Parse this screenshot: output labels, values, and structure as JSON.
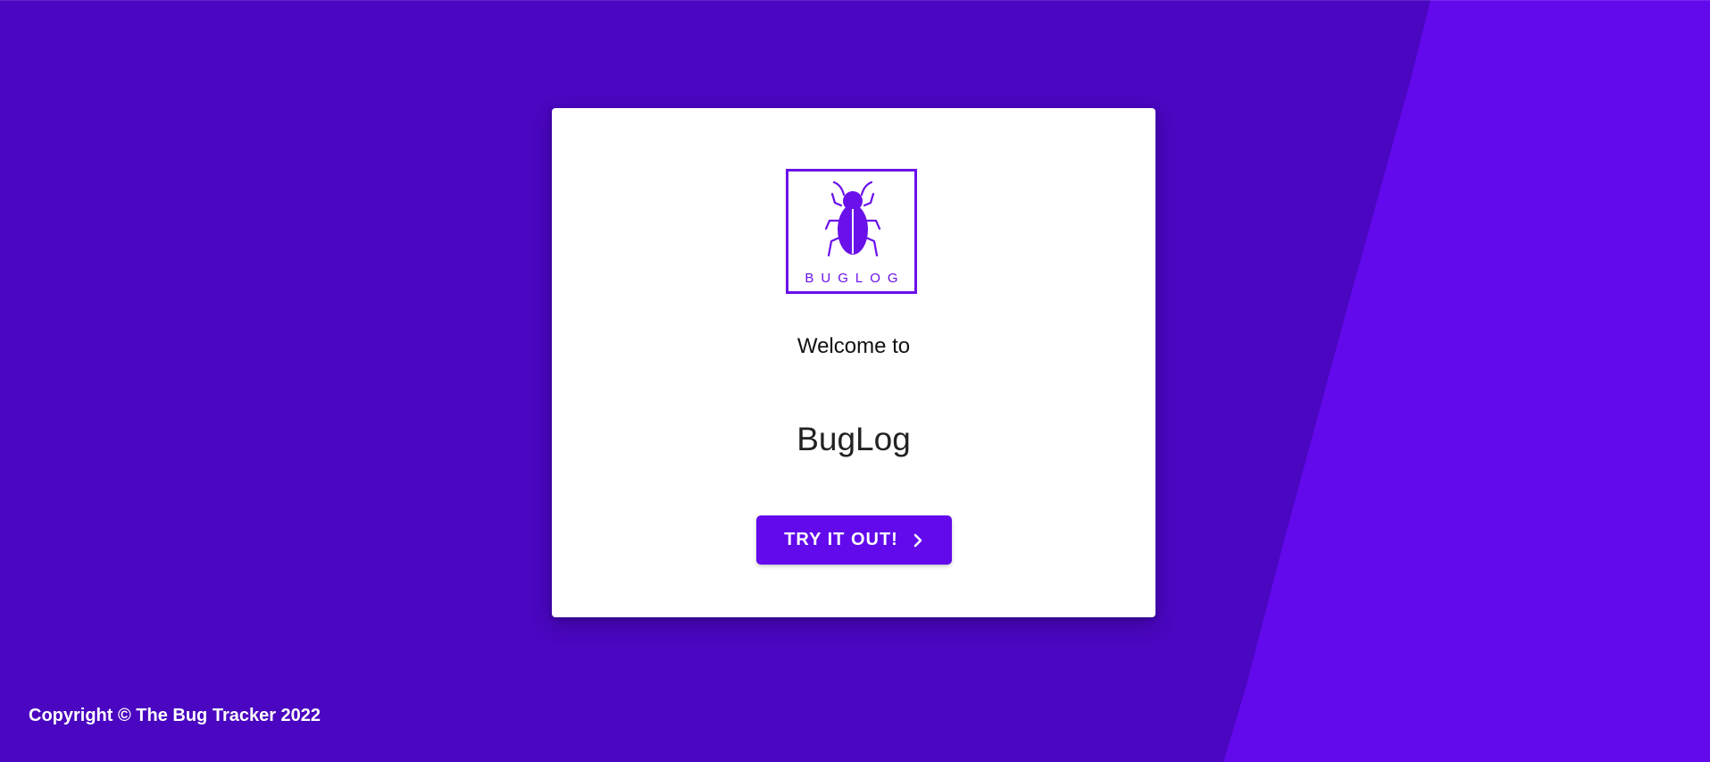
{
  "colors": {
    "background": "#4a06c0",
    "accent_shape": "#620aeb",
    "card": "#ffffff",
    "brand_purple": "#6a10ea",
    "button": "#620aeb",
    "text_dark": "#222222",
    "text_light": "#ffffff"
  },
  "logo": {
    "text": "BUGLOG",
    "icon": "bug-icon"
  },
  "card": {
    "welcome_text": "Welcome to",
    "title": "BugLog"
  },
  "cta": {
    "label": "TRY IT OUT!",
    "icon": "chevron-right-icon"
  },
  "footer": {
    "copyright": "Copyright © The Bug Tracker 2022"
  }
}
